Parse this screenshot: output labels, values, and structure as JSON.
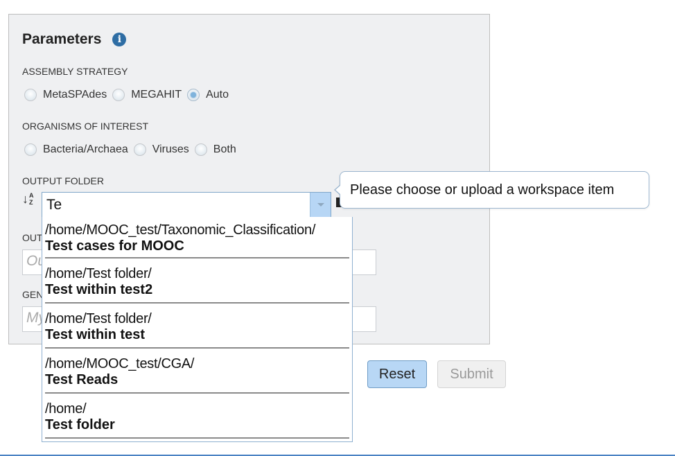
{
  "parameters": {
    "title": "Parameters",
    "info_icon": "info-circle-icon",
    "assembly_strategy": {
      "label": "ASSEMBLY STRATEGY",
      "options": [
        {
          "label": "MetaSPAdes",
          "checked": false
        },
        {
          "label": "MEGAHIT",
          "checked": false
        },
        {
          "label": "Auto",
          "checked": true
        }
      ]
    },
    "organisms_of_interest": {
      "label": "ORGANISMS OF INTEREST",
      "options": [
        {
          "label": "Bacteria/Archaea",
          "checked": false
        },
        {
          "label": "Viruses",
          "checked": false
        },
        {
          "label": "Both",
          "checked": false
        }
      ]
    },
    "output_folder": {
      "label": "OUTPUT FOLDER",
      "sort_icon": "sort-alpha-down-icon",
      "value": "Te",
      "folder_icon": "folder-icon",
      "tooltip": "Please choose or upload a workspace item",
      "dropdown_items": [
        {
          "path": "/home/MOOC_test/Taxonomic_Classification/",
          "name": "Test cases for MOOC"
        },
        {
          "path": "/home/Test folder/",
          "name": "Test within test2"
        },
        {
          "path": "/home/Test folder/",
          "name": "Test within test"
        },
        {
          "path": "/home/MOOC_test/CGA/",
          "name": "Test Reads"
        },
        {
          "path": "/home/",
          "name": "Test folder"
        }
      ]
    },
    "output_name": {
      "label_partial": "OUT",
      "placeholder_partial": "Ou"
    },
    "genome_group": {
      "label_partial": "GEN",
      "placeholder_partial": "My"
    }
  },
  "buttons": {
    "reset": "Reset",
    "submit": "Submit"
  },
  "colors": {
    "panel_bg": "#eff0f2",
    "accent_blue": "#b8d7f5",
    "info_icon": "#2e6da4",
    "bottom_line": "#4a82c3"
  }
}
